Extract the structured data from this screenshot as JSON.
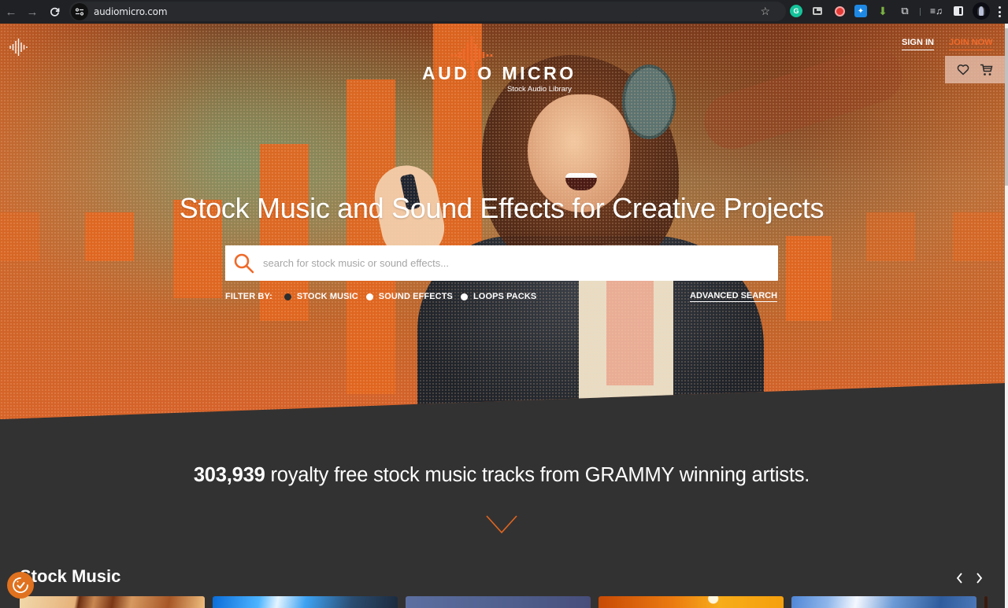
{
  "browser": {
    "url": "audiomicro.com",
    "extensions": [
      "grammarly-icon",
      "picture-in-picture-icon",
      "record-icon",
      "bird-extension-icon",
      "download-icon",
      "extensions-puzzle-icon"
    ],
    "grammarly_letter": "G"
  },
  "header": {
    "logo_text": "AUD O MICRO",
    "logo_subtitle": "Stock Audio Library",
    "sign_in": "SIGN IN",
    "join_now": "JOIN NOW",
    "accent_color": "#f06a2a"
  },
  "hero": {
    "headline": "Stock Music and Sound Effects for Creative Projects",
    "search": {
      "placeholder": "search for stock music or sound effects...",
      "value": ""
    },
    "filter": {
      "label": "FILTER BY:",
      "options": [
        {
          "label": "STOCK MUSIC",
          "checked": true
        },
        {
          "label": "SOUND EFFECTS",
          "checked": false
        },
        {
          "label": "LOOPS PACKS",
          "checked": false
        }
      ]
    },
    "advanced_search": "ADVANCED SEARCH"
  },
  "stats": {
    "count": "303,939",
    "text": " royalty free stock music tracks from GRAMMY winning artists."
  },
  "carousel": {
    "title": "Stock Music",
    "prev_icon": "chevron-left-icon",
    "next_icon": "chevron-right-icon",
    "thumbnails": [
      "architecture",
      "concert-lights",
      "blue-gradient",
      "sunset",
      "sky-building"
    ]
  },
  "cookie_badge": {
    "icon": "cookie-consent-icon"
  }
}
